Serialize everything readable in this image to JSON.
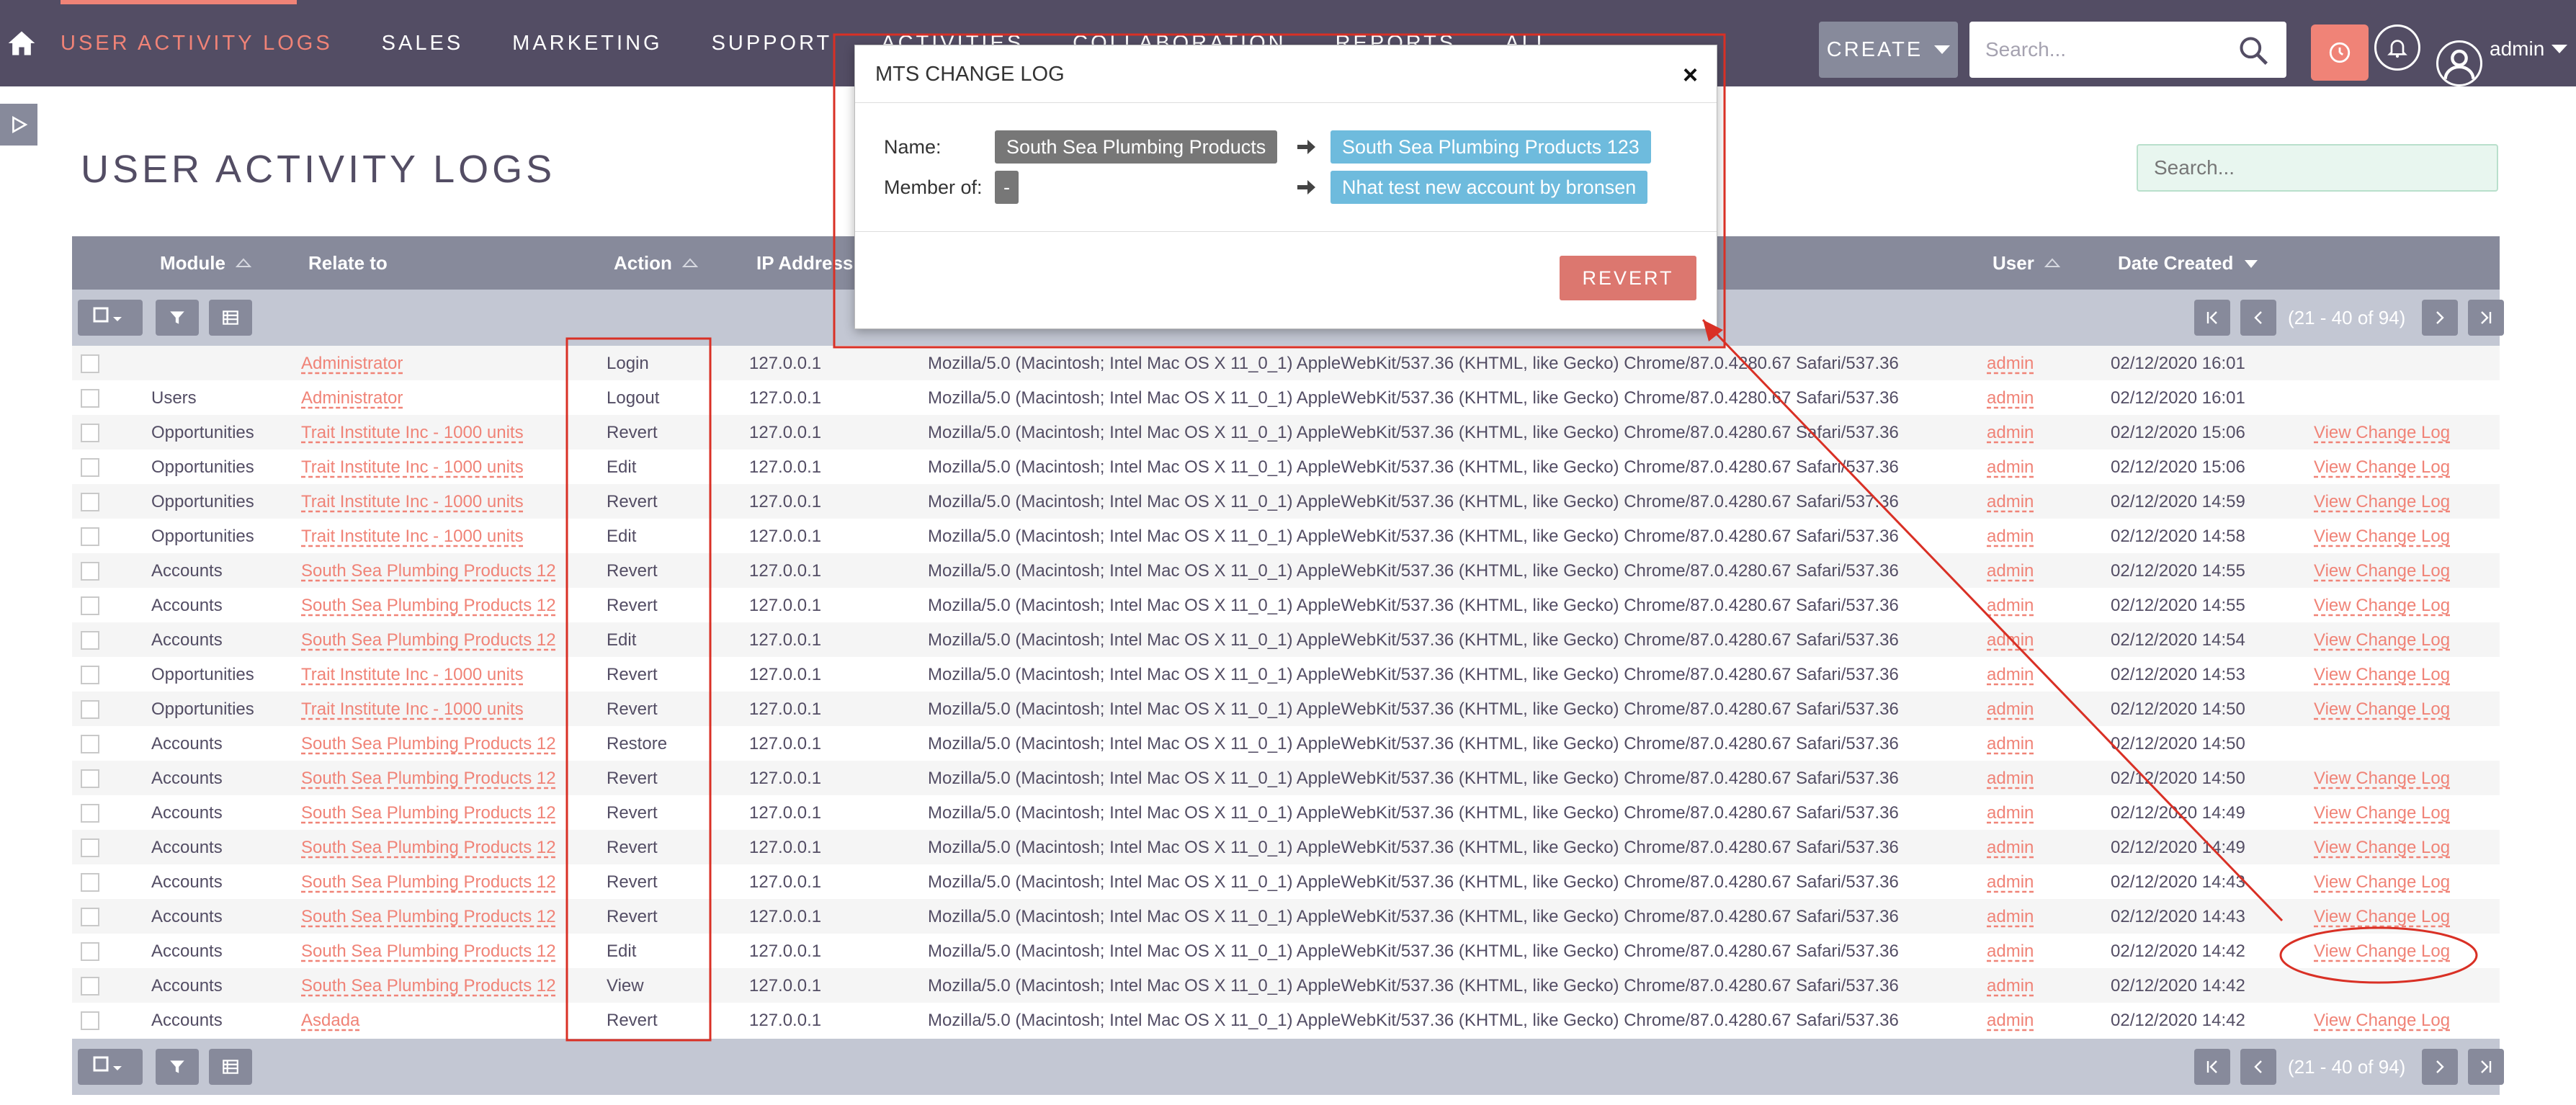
{
  "nav": {
    "items": [
      "USER ACTIVITY LOGS",
      "SALES",
      "MARKETING",
      "SUPPORT",
      "ACTIVITIES",
      "COLLABORATION",
      "REPORTS",
      "ALL"
    ],
    "create_label": "CREATE",
    "search_placeholder": "Search...",
    "user_name": "admin"
  },
  "page": {
    "title": "USER ACTIVITY LOGS",
    "search_placeholder": "Search..."
  },
  "table": {
    "headers": {
      "module": "Module",
      "relate_to": "Relate to",
      "action": "Action",
      "ip": "IP Address",
      "user": "User",
      "date_created": "Date Created"
    },
    "pagination": "(21 - 40 of 94)",
    "rows": [
      {
        "module": "",
        "relate": "Administrator",
        "action": "Login",
        "ip": "127.0.0.1",
        "agent": "Mozilla/5.0 (Macintosh; Intel Mac OS X 11_0_1) AppleWebKit/537.36 (KHTML, like Gecko) Chrome/87.0.4280.67 Safari/537.36",
        "user": "admin",
        "date": "02/12/2020 16:01",
        "link": ""
      },
      {
        "module": "Users",
        "relate": "Administrator",
        "action": "Logout",
        "ip": "127.0.0.1",
        "agent": "Mozilla/5.0 (Macintosh; Intel Mac OS X 11_0_1) AppleWebKit/537.36 (KHTML, like Gecko) Chrome/87.0.4280.67 Safari/537.36",
        "user": "admin",
        "date": "02/12/2020 16:01",
        "link": ""
      },
      {
        "module": "Opportunities",
        "relate": "Trait Institute Inc - 1000 units",
        "action": "Revert",
        "ip": "127.0.0.1",
        "agent": "Mozilla/5.0 (Macintosh; Intel Mac OS X 11_0_1) AppleWebKit/537.36 (KHTML, like Gecko) Chrome/87.0.4280.67 Safari/537.36",
        "user": "admin",
        "date": "02/12/2020 15:06",
        "link": "View Change Log"
      },
      {
        "module": "Opportunities",
        "relate": "Trait Institute Inc - 1000 units",
        "action": "Edit",
        "ip": "127.0.0.1",
        "agent": "Mozilla/5.0 (Macintosh; Intel Mac OS X 11_0_1) AppleWebKit/537.36 (KHTML, like Gecko) Chrome/87.0.4280.67 Safari/537.36",
        "user": "admin",
        "date": "02/12/2020 15:06",
        "link": "View Change Log"
      },
      {
        "module": "Opportunities",
        "relate": "Trait Institute Inc - 1000 units",
        "action": "Revert",
        "ip": "127.0.0.1",
        "agent": "Mozilla/5.0 (Macintosh; Intel Mac OS X 11_0_1) AppleWebKit/537.36 (KHTML, like Gecko) Chrome/87.0.4280.67 Safari/537.36",
        "user": "admin",
        "date": "02/12/2020 14:59",
        "link": "View Change Log"
      },
      {
        "module": "Opportunities",
        "relate": "Trait Institute Inc - 1000 units",
        "action": "Edit",
        "ip": "127.0.0.1",
        "agent": "Mozilla/5.0 (Macintosh; Intel Mac OS X 11_0_1) AppleWebKit/537.36 (KHTML, like Gecko) Chrome/87.0.4280.67 Safari/537.36",
        "user": "admin",
        "date": "02/12/2020 14:58",
        "link": "View Change Log"
      },
      {
        "module": "Accounts",
        "relate": "South Sea Plumbing Products 12",
        "action": "Revert",
        "ip": "127.0.0.1",
        "agent": "Mozilla/5.0 (Macintosh; Intel Mac OS X 11_0_1) AppleWebKit/537.36 (KHTML, like Gecko) Chrome/87.0.4280.67 Safari/537.36",
        "user": "admin",
        "date": "02/12/2020 14:55",
        "link": "View Change Log"
      },
      {
        "module": "Accounts",
        "relate": "South Sea Plumbing Products 12",
        "action": "Revert",
        "ip": "127.0.0.1",
        "agent": "Mozilla/5.0 (Macintosh; Intel Mac OS X 11_0_1) AppleWebKit/537.36 (KHTML, like Gecko) Chrome/87.0.4280.67 Safari/537.36",
        "user": "admin",
        "date": "02/12/2020 14:55",
        "link": "View Change Log"
      },
      {
        "module": "Accounts",
        "relate": "South Sea Plumbing Products 12",
        "action": "Edit",
        "ip": "127.0.0.1",
        "agent": "Mozilla/5.0 (Macintosh; Intel Mac OS X 11_0_1) AppleWebKit/537.36 (KHTML, like Gecko) Chrome/87.0.4280.67 Safari/537.36",
        "user": "admin",
        "date": "02/12/2020 14:54",
        "link": "View Change Log"
      },
      {
        "module": "Opportunities",
        "relate": "Trait Institute Inc - 1000 units",
        "action": "Revert",
        "ip": "127.0.0.1",
        "agent": "Mozilla/5.0 (Macintosh; Intel Mac OS X 11_0_1) AppleWebKit/537.36 (KHTML, like Gecko) Chrome/87.0.4280.67 Safari/537.36",
        "user": "admin",
        "date": "02/12/2020 14:53",
        "link": "View Change Log"
      },
      {
        "module": "Opportunities",
        "relate": "Trait Institute Inc - 1000 units",
        "action": "Revert",
        "ip": "127.0.0.1",
        "agent": "Mozilla/5.0 (Macintosh; Intel Mac OS X 11_0_1) AppleWebKit/537.36 (KHTML, like Gecko) Chrome/87.0.4280.67 Safari/537.36",
        "user": "admin",
        "date": "02/12/2020 14:50",
        "link": "View Change Log"
      },
      {
        "module": "Accounts",
        "relate": "South Sea Plumbing Products 12",
        "action": "Restore",
        "ip": "127.0.0.1",
        "agent": "Mozilla/5.0 (Macintosh; Intel Mac OS X 11_0_1) AppleWebKit/537.36 (KHTML, like Gecko) Chrome/87.0.4280.67 Safari/537.36",
        "user": "admin",
        "date": "02/12/2020 14:50",
        "link": ""
      },
      {
        "module": "Accounts",
        "relate": "South Sea Plumbing Products 12",
        "action": "Revert",
        "ip": "127.0.0.1",
        "agent": "Mozilla/5.0 (Macintosh; Intel Mac OS X 11_0_1) AppleWebKit/537.36 (KHTML, like Gecko) Chrome/87.0.4280.67 Safari/537.36",
        "user": "admin",
        "date": "02/12/2020 14:50",
        "link": "View Change Log"
      },
      {
        "module": "Accounts",
        "relate": "South Sea Plumbing Products 12",
        "action": "Revert",
        "ip": "127.0.0.1",
        "agent": "Mozilla/5.0 (Macintosh; Intel Mac OS X 11_0_1) AppleWebKit/537.36 (KHTML, like Gecko) Chrome/87.0.4280.67 Safari/537.36",
        "user": "admin",
        "date": "02/12/2020 14:49",
        "link": "View Change Log"
      },
      {
        "module": "Accounts",
        "relate": "South Sea Plumbing Products 12",
        "action": "Revert",
        "ip": "127.0.0.1",
        "agent": "Mozilla/5.0 (Macintosh; Intel Mac OS X 11_0_1) AppleWebKit/537.36 (KHTML, like Gecko) Chrome/87.0.4280.67 Safari/537.36",
        "user": "admin",
        "date": "02/12/2020 14:49",
        "link": "View Change Log"
      },
      {
        "module": "Accounts",
        "relate": "South Sea Plumbing Products 12",
        "action": "Revert",
        "ip": "127.0.0.1",
        "agent": "Mozilla/5.0 (Macintosh; Intel Mac OS X 11_0_1) AppleWebKit/537.36 (KHTML, like Gecko) Chrome/87.0.4280.67 Safari/537.36",
        "user": "admin",
        "date": "02/12/2020 14:43",
        "link": "View Change Log"
      },
      {
        "module": "Accounts",
        "relate": "South Sea Plumbing Products 12",
        "action": "Revert",
        "ip": "127.0.0.1",
        "agent": "Mozilla/5.0 (Macintosh; Intel Mac OS X 11_0_1) AppleWebKit/537.36 (KHTML, like Gecko) Chrome/87.0.4280.67 Safari/537.36",
        "user": "admin",
        "date": "02/12/2020 14:43",
        "link": "View Change Log"
      },
      {
        "module": "Accounts",
        "relate": "South Sea Plumbing Products 12",
        "action": "Edit",
        "ip": "127.0.0.1",
        "agent": "Mozilla/5.0 (Macintosh; Intel Mac OS X 11_0_1) AppleWebKit/537.36 (KHTML, like Gecko) Chrome/87.0.4280.67 Safari/537.36",
        "user": "admin",
        "date": "02/12/2020 14:42",
        "link": "View Change Log"
      },
      {
        "module": "Accounts",
        "relate": "South Sea Plumbing Products 12",
        "action": "View",
        "ip": "127.0.0.1",
        "agent": "Mozilla/5.0 (Macintosh; Intel Mac OS X 11_0_1) AppleWebKit/537.36 (KHTML, like Gecko) Chrome/87.0.4280.67 Safari/537.36",
        "user": "admin",
        "date": "02/12/2020 14:42",
        "link": ""
      },
      {
        "module": "Accounts",
        "relate": "Asdada",
        "action": "Revert",
        "ip": "127.0.0.1",
        "agent": "Mozilla/5.0 (Macintosh; Intel Mac OS X 11_0_1) AppleWebKit/537.36 (KHTML, like Gecko) Chrome/87.0.4280.67 Safari/537.36",
        "user": "admin",
        "date": "02/12/2020 14:42",
        "link": "View Change Log"
      }
    ]
  },
  "modal": {
    "title": "MTS CHANGE LOG",
    "close": "×",
    "name_label": "Name:",
    "name_old": "South Sea Plumbing Products",
    "name_new": "South Sea Plumbing Products 123",
    "member_label": "Member of:",
    "member_old": "-",
    "member_new": "Nhat test new account by bronsen",
    "revert_label": "REVERT"
  },
  "colors": {
    "nav_bg": "#534d64",
    "accent": "#f08377",
    "header_bg": "#878a9b",
    "toolbar_bg": "#c3c7d3",
    "tag_old": "#777777",
    "tag_new": "#6ebbdd",
    "revert_btn": "#dc776f",
    "annotation": "#d93025"
  },
  "icons": {
    "home": "home-icon",
    "search": "search-icon",
    "alert": "clock-alert-icon",
    "bell": "bell-icon",
    "user": "user-avatar-icon",
    "filter": "filter-icon",
    "columns": "columns-icon",
    "checkbox": "checkbox-icon",
    "arrow": "arrow-right-icon"
  }
}
